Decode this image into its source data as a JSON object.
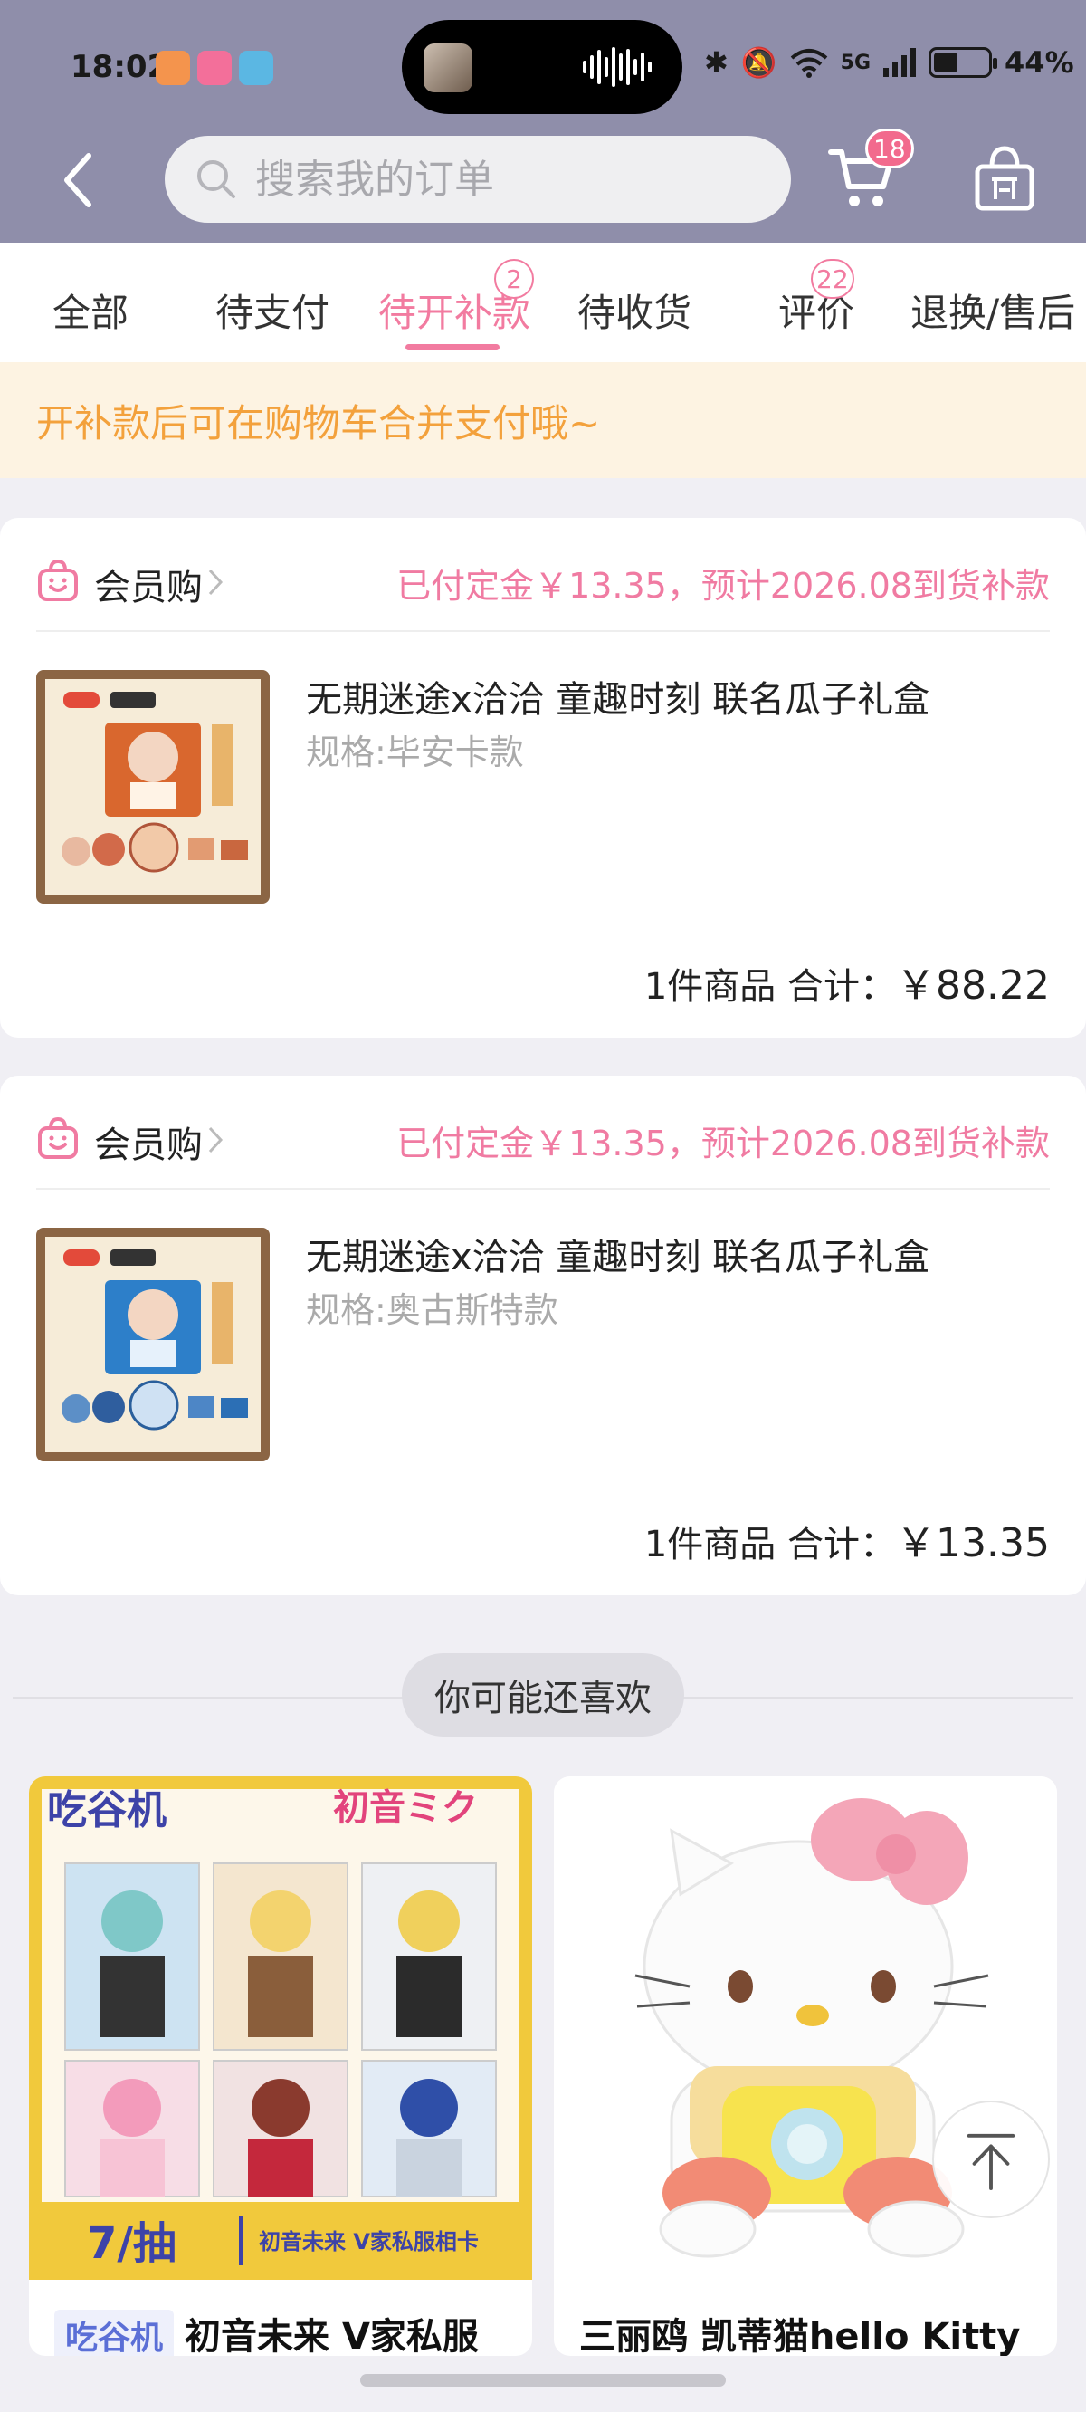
{
  "status_bar": {
    "time": "18:02",
    "network": "5G",
    "battery": "44%",
    "battery_level": 0.44
  },
  "header": {
    "search_placeholder": "搜索我的订单",
    "cart_badge": "18",
    "icons": [
      "back-arrow-icon",
      "search-icon",
      "cart-icon",
      "shopping-bag-icon"
    ]
  },
  "tabs": [
    {
      "label": "全部",
      "badge": ""
    },
    {
      "label": "待支付",
      "badge": ""
    },
    {
      "label": "待开补款",
      "badge": "2",
      "active": true
    },
    {
      "label": "待收货",
      "badge": ""
    },
    {
      "label": "评价",
      "badge": "22"
    },
    {
      "label": "退换/售后",
      "badge": ""
    }
  ],
  "notice": "开补款后可在购物车合并支付哦~",
  "orders": [
    {
      "shop": "会员购",
      "status": "已付定金￥13.35，预计2026.08到货补款",
      "title": "无期迷途x洽洽 童趣时刻 联名瓜子礼盒",
      "spec": "规格:毕安卡款",
      "count_label": "1件商品 合计：",
      "price": "￥88.22"
    },
    {
      "shop": "会员购",
      "status": "已付定金￥13.35，预计2026.08到货补款",
      "title": "无期迷途x洽洽 童趣时刻 联名瓜子礼盒",
      "spec": "规格:奥古斯特款",
      "count_label": "1件商品 合计：",
      "price": "￥13.35"
    }
  ],
  "recommend": {
    "heading": "你可能还喜欢",
    "items": [
      {
        "tag": "吃谷机",
        "title": "初音未来 V家私服",
        "banner_top": "吃谷机",
        "logo": "初音ミク",
        "banner_price": "7/抽",
        "banner_caption": "初音未来 V家私服相卡"
      },
      {
        "tag": "",
        "title": "三丽鸥 凯蒂猫hello Kitty"
      }
    ]
  },
  "colors": {
    "header_bg": "#8f8eaa",
    "accent_pink": "#f27ba0",
    "notice_text": "#f3a13c",
    "notice_bg": "#fdf3e2"
  }
}
